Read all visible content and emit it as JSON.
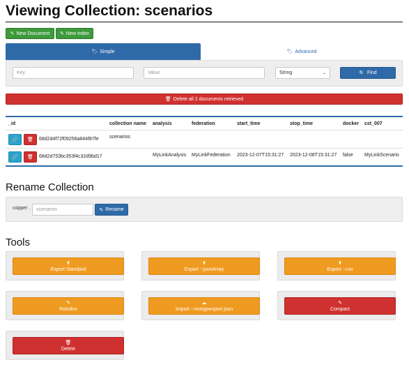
{
  "page": {
    "title": "Viewing Collection: scenarios"
  },
  "toolbar": {
    "new_document": "New Document",
    "new_index": "New Index"
  },
  "tabs": [
    {
      "label": "Simple",
      "active": true
    },
    {
      "label": "Advanced",
      "active": false
    }
  ],
  "search": {
    "key_placeholder": "Key",
    "value_placeholder": "Value",
    "type_selected": "String",
    "find_label": "Find"
  },
  "delete_all": {
    "label": "Delete all 2 documents retrieved"
  },
  "table": {
    "headers": [
      "_id",
      "collection name",
      "analysis",
      "federation",
      "start_time",
      "stop_time",
      "docker",
      "cst_007"
    ],
    "rows": [
      {
        "id": "68d2d4f72f09256a844f87fe",
        "collection_name": "scenarios",
        "analysis": "",
        "federation": "",
        "start_time": "",
        "stop_time": "",
        "docker": "",
        "cst_007": ""
      },
      {
        "id": "68d2d753bc353f4c32d9bd17",
        "collection_name": "",
        "analysis": "MyLinkAnalysis",
        "federation": "MyLinkFederation",
        "start_time": "2023-12-07T15:31:27",
        "stop_time": "2023-12-08T15:31:27",
        "docker": "false",
        "cst_007": "MyLinkScenario"
      }
    ]
  },
  "rename": {
    "title": "Rename Collection",
    "prefix": "copper .",
    "input_value": "scenarios",
    "button_label": "Rename"
  },
  "tools": {
    "title": "Tools",
    "buttons": [
      {
        "label": "Export Standard",
        "icon": "export-icon",
        "color": "#ef9a21"
      },
      {
        "label": "Export --jsonArray",
        "icon": "export-icon",
        "color": "#ef9a21"
      },
      {
        "label": "Export --csv",
        "icon": "export-icon",
        "color": "#ef9a21"
      },
      {
        "label": "Reindex",
        "icon": "wrench-icon",
        "color": "#ef9a21"
      },
      {
        "label": "Import --mongoexport json",
        "icon": "upload-icon",
        "color": "#ef9a21"
      },
      {
        "label": "Compact",
        "icon": "wrench-icon",
        "color": "#cf3130"
      },
      {
        "label": "Delete",
        "icon": "trash-icon",
        "color": "#cf3130"
      }
    ]
  },
  "colors": {
    "primary": "#2f6aa8",
    "success": "#3e9a3c",
    "danger": "#cf3130",
    "warning": "#ef9a21",
    "info": "#2ba3cf"
  }
}
